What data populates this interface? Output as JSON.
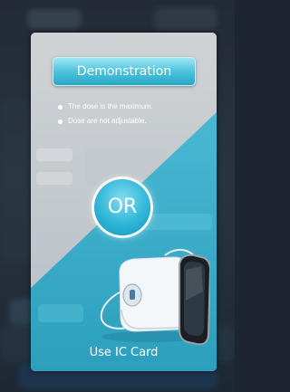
{
  "dialog": {
    "demo_button_label": "Demonstration",
    "notes": [
      "The dose  is the maximum.",
      "Dose  are not adjustable."
    ],
    "or_label": "OR",
    "ic_card_label": "Use IC Card"
  },
  "colors": {
    "accent": "#2fb6d8",
    "card_gray": "#c6cbcf",
    "card_teal": "#3aaecb"
  },
  "icons": {
    "device": "ic-card-reader-device-icon",
    "card_slot": "card-slot-icon"
  }
}
